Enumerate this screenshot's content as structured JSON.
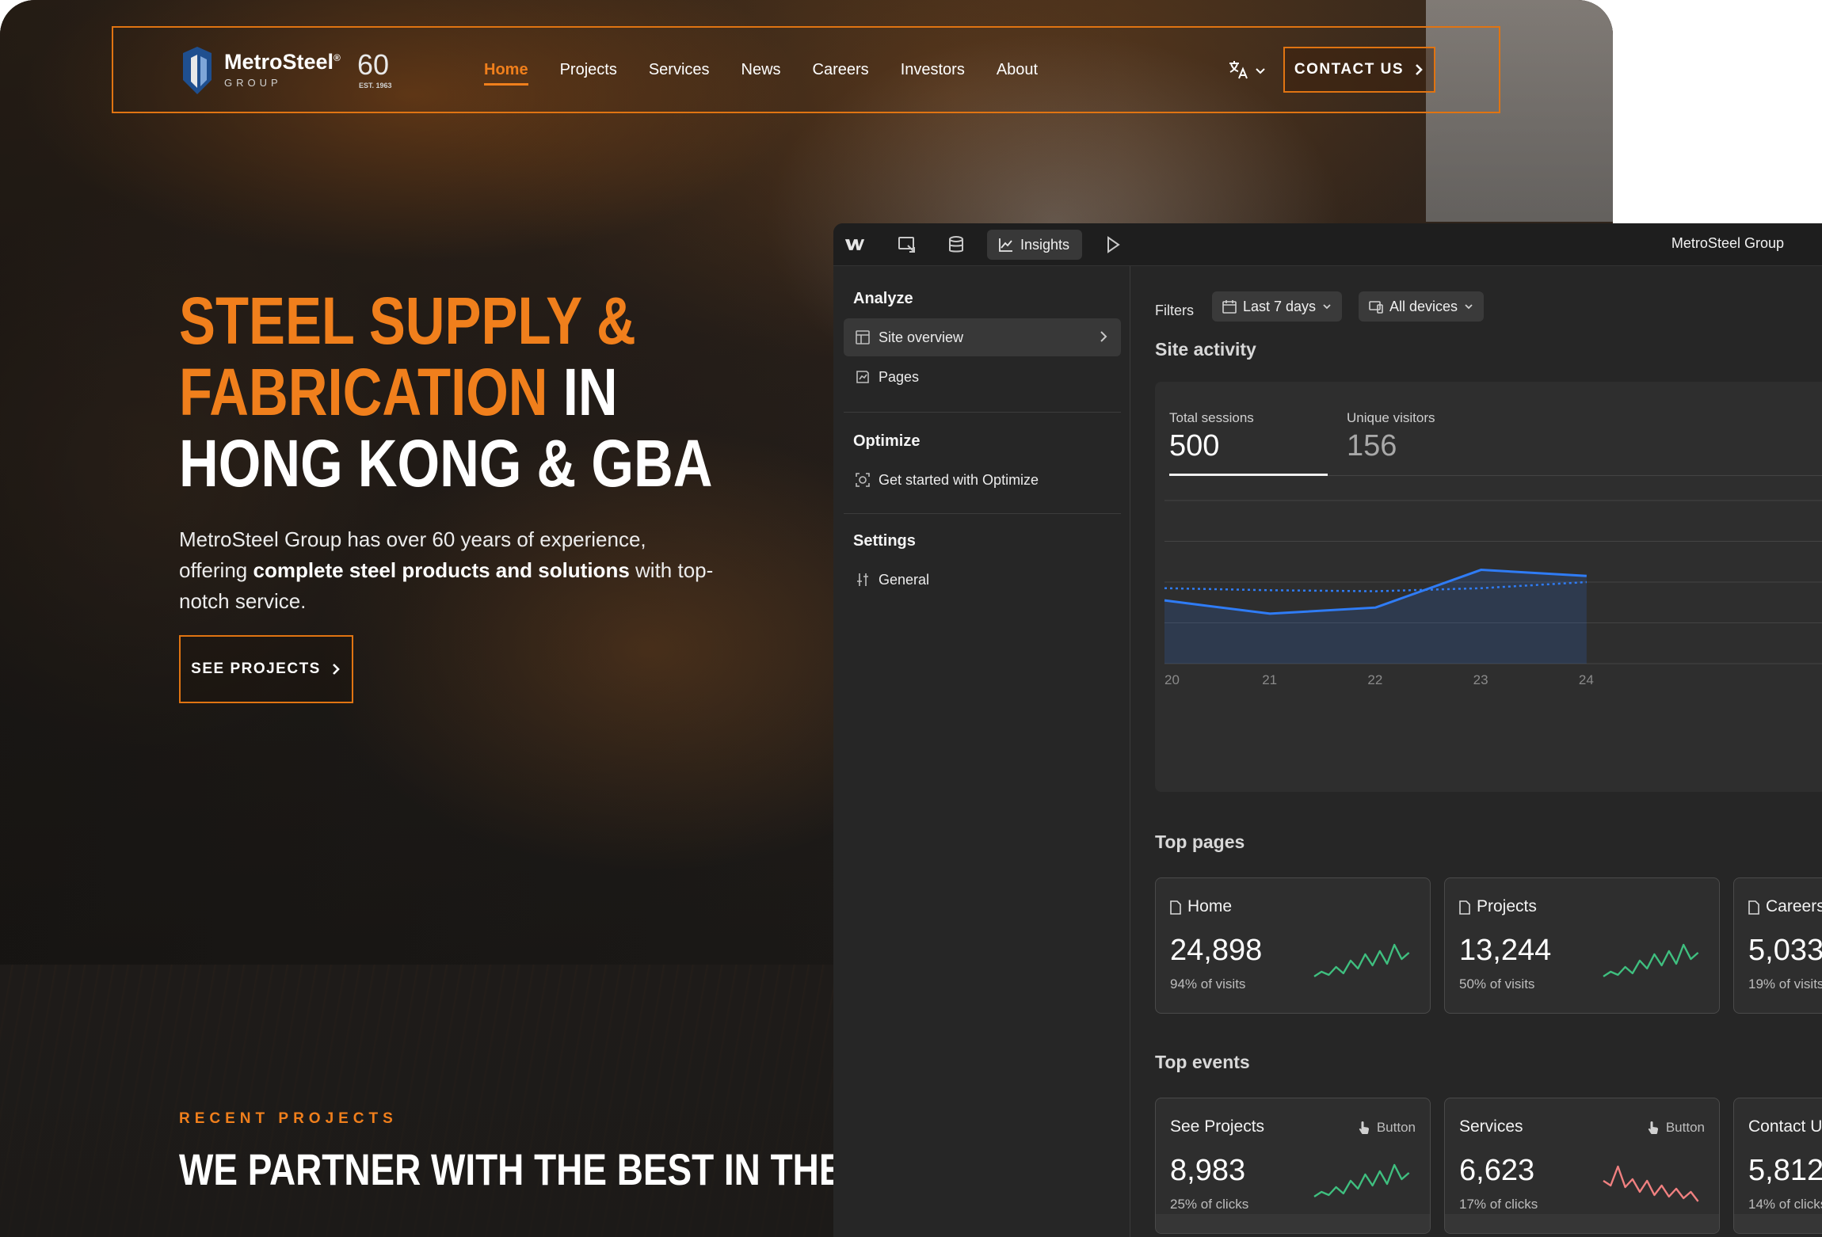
{
  "site": {
    "logo": {
      "name": "MetroSteel",
      "reg": "®",
      "group": "GROUP",
      "anniv": "60",
      "est": "EST. 1963"
    },
    "nav": [
      {
        "label": "Home",
        "active": true
      },
      {
        "label": "Projects"
      },
      {
        "label": "Services"
      },
      {
        "label": "News"
      },
      {
        "label": "Careers"
      },
      {
        "label": "Investors"
      },
      {
        "label": "About"
      }
    ],
    "contact_label": "CONTACT US",
    "hero": {
      "line1": "STEEL SUPPLY &",
      "line2_highlight": "FABRICATION",
      "line2_rest": " IN",
      "line3": "HONG KONG & GBA",
      "desc_pre": "MetroSteel Group has over 60 years of experience, offering ",
      "desc_bold": "complete steel products and solutions",
      "desc_post": " with top-notch service.",
      "cta": "SEE PROJECTS"
    },
    "recent_label": "RECENT PROJECTS",
    "partner_title": "WE PARTNER WITH THE BEST IN THE INDUS",
    "accent": "#f07f1c"
  },
  "panel": {
    "site_name": "MetroSteel Group",
    "insights_label": "Insights",
    "sidebar": {
      "analyze": "Analyze",
      "site_overview": "Site overview",
      "pages": "Pages",
      "optimize": "Optimize",
      "get_started": "Get started with Optimize",
      "settings": "Settings",
      "general": "General"
    },
    "filters": {
      "label": "Filters",
      "range": "Last 7 days",
      "devices": "All devices"
    },
    "site_activity": {
      "title": "Site activity",
      "total_label": "Total sessions",
      "total_value": "500",
      "unique_label": "Unique visitors",
      "unique_value": "156"
    },
    "top_pages": {
      "title": "Top pages",
      "items": [
        {
          "name": "Home",
          "value": "24,898",
          "sub": "94% of visits"
        },
        {
          "name": "Projects",
          "value": "13,244",
          "sub": "50% of visits"
        },
        {
          "name": "Careers",
          "value": "5,033",
          "sub": "19% of visits"
        }
      ]
    },
    "top_events": {
      "title": "Top events",
      "items": [
        {
          "name": "See Projects",
          "kind": "Button",
          "value": "8,983",
          "sub": "25% of clicks",
          "trend": "up"
        },
        {
          "name": "Services",
          "kind": "Button",
          "value": "6,623",
          "sub": "17% of clicks",
          "trend": "down"
        },
        {
          "name": "Contact Us",
          "kind": "Button",
          "value": "5,812",
          "sub": "14% of clicks",
          "trend": "up"
        }
      ]
    },
    "colors": {
      "line": "#2f7cf6",
      "spark_up": "#3fbf7f",
      "spark_down": "#f08080"
    }
  },
  "chart_data": {
    "type": "line",
    "x": [
      "20",
      "21",
      "22",
      "23",
      "24"
    ],
    "series": [
      {
        "values": [
          62,
          49,
          55,
          92,
          86
        ]
      },
      {
        "values": [
          74,
          72,
          71,
          74,
          80
        ]
      }
    ],
    "ylim": [
      0,
      160
    ],
    "grid": true
  }
}
